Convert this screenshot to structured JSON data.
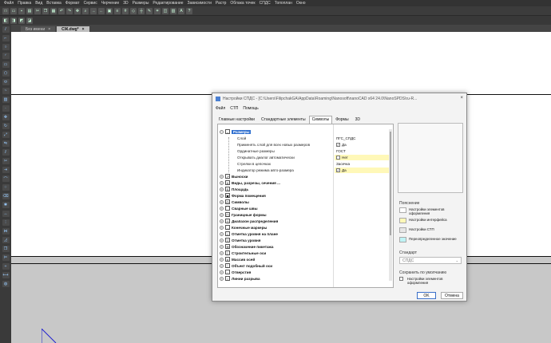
{
  "menubar": [
    "Файл",
    "Правка",
    "Вид",
    "Вставка",
    "Формат",
    "Сервис",
    "Черчение",
    "3D",
    "Размеры",
    "Редактирование",
    "Зависимости",
    "Растр",
    "Облака точек",
    "СПДС",
    "Топоплан",
    "Окно"
  ],
  "doc_tabs": [
    {
      "label": "Без имени",
      "close": "×"
    },
    {
      "label": "СЖ.dwg*",
      "close": "×"
    }
  ],
  "dialog": {
    "title": "Настройки СПДС - [C:\\Users\\FilipchakGA\\AppData\\Roaming\\Nanosoft\\nanoCAD x64 24.0\\NanoSPDS\\ru-R...",
    "close": "×",
    "menu": [
      "Файл",
      "СТП",
      "Помощь"
    ],
    "tabs": [
      "Главные настройки",
      "Стандартные элементы",
      "Символы",
      "Формы",
      "3D"
    ],
    "selected_category": "Размеры",
    "properties": [
      {
        "name": "Слой",
        "value": "ПГС_СПДС"
      },
      {
        "name": "Применять слой для всех новых размеров",
        "value": "Да",
        "check": "✓"
      },
      {
        "name": "Ординатные размеры",
        "value": "ГОСТ"
      },
      {
        "name": "Открывать диалог автоматически",
        "value": "Нет",
        "check": ""
      },
      {
        "name": "Стрелки в цепочках",
        "value": "Засечка"
      },
      {
        "name": "Индикатор режима авто-размера",
        "value": "Да",
        "check": "✓"
      }
    ],
    "categories": [
      "Выноски",
      "Виды, разрезы, сечения ...",
      "Площадь",
      "Форма помещения",
      "Символы",
      "Сварные швы",
      "Границные формы",
      "Диапазон распределения",
      "Конечные маркеры",
      "Отметка уровня на плане",
      "Отметка уровня",
      "Обозначение пикетажа",
      "Строительные оси",
      "Массив осей",
      "Объект подобный оси",
      "Отверстия",
      "Линии разрыва"
    ],
    "legend": {
      "title": "Пояснение",
      "items": [
        {
          "label": "Настройки элементов оформления",
          "color": "#ffffff"
        },
        {
          "label": "Настройки интерфейса",
          "color": "#fff8b8"
        },
        {
          "label": "Настройки СТП",
          "color": "#e6e6e6"
        },
        {
          "label": "Переопределенное значение",
          "color": "#bff3f5"
        }
      ]
    },
    "standard_label": "Стандарт",
    "standard_value": "СПДС",
    "save_default_label": "Сохранить по умолчанию",
    "save_default_check": "Настройки элементов оформления",
    "ok": "OK",
    "cancel": "Отмена"
  }
}
